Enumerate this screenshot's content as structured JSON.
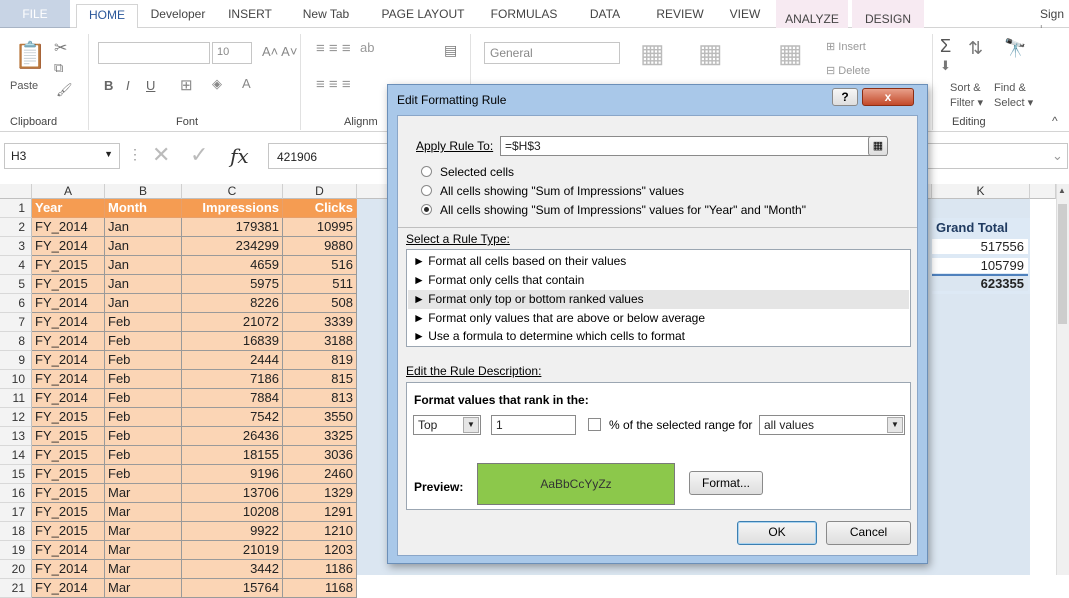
{
  "ribbon_tabs": [
    "FILE",
    "HOME",
    "Developer",
    "INSERT",
    "New Tab",
    "PAGE LAYOUT",
    "FORMULAS",
    "DATA",
    "REVIEW",
    "VIEW",
    "ANALYZE",
    "DESIGN"
  ],
  "sign_in": "Sign i",
  "ribbon": {
    "clipboard": {
      "label": "Clipboard",
      "paste": "Paste"
    },
    "font": {
      "label": "Font",
      "size": "10",
      "bold": "B",
      "italic": "I",
      "underline": "U"
    },
    "alignment": {
      "label": "Alignm"
    },
    "number": {
      "format": "General"
    },
    "cells": {
      "insert": "Insert",
      "delete": "Delete"
    },
    "editing": {
      "label": "Editing",
      "sort": "Sort &",
      "filter": "Filter",
      "find": "Find &",
      "select": "Select"
    }
  },
  "formula_bar": {
    "name_box": "H3",
    "fx": "fx",
    "value": "421906"
  },
  "columns": [
    "A",
    "B",
    "C",
    "D"
  ],
  "col_k": "K",
  "table": {
    "headers": [
      "Year",
      "Month",
      "Impressions",
      "Clicks"
    ],
    "rows": [
      [
        "FY_2014",
        "Jan",
        "179381",
        "10995"
      ],
      [
        "FY_2014",
        "Jan",
        "234299",
        "9880"
      ],
      [
        "FY_2015",
        "Jan",
        "4659",
        "516"
      ],
      [
        "FY_2015",
        "Jan",
        "5975",
        "511"
      ],
      [
        "FY_2014",
        "Jan",
        "8226",
        "508"
      ],
      [
        "FY_2014",
        "Feb",
        "21072",
        "3339"
      ],
      [
        "FY_2014",
        "Feb",
        "16839",
        "3188"
      ],
      [
        "FY_2014",
        "Feb",
        "2444",
        "819"
      ],
      [
        "FY_2014",
        "Feb",
        "7186",
        "815"
      ],
      [
        "FY_2014",
        "Feb",
        "7884",
        "813"
      ],
      [
        "FY_2015",
        "Feb",
        "7542",
        "3550"
      ],
      [
        "FY_2015",
        "Feb",
        "26436",
        "3325"
      ],
      [
        "FY_2015",
        "Feb",
        "18155",
        "3036"
      ],
      [
        "FY_2015",
        "Feb",
        "9196",
        "2460"
      ],
      [
        "FY_2015",
        "Mar",
        "13706",
        "1329"
      ],
      [
        "FY_2015",
        "Mar",
        "10208",
        "1291"
      ],
      [
        "FY_2015",
        "Mar",
        "9922",
        "1210"
      ],
      [
        "FY_2014",
        "Mar",
        "21019",
        "1203"
      ],
      [
        "FY_2014",
        "Mar",
        "3442",
        "1186"
      ],
      [
        "FY_2014",
        "Mar",
        "15764",
        "1168"
      ]
    ]
  },
  "grand_total": {
    "label": "Grand Total",
    "values": [
      "517556",
      "105799",
      "623355"
    ]
  },
  "dialog": {
    "title": "Edit Formatting Rule",
    "apply_label": "Apply Rule To:",
    "apply_value": "=$H$3",
    "scope_options": [
      "Selected cells",
      "All cells showing \"Sum of Impressions\" values",
      "All cells showing \"Sum of Impressions\" values for \"Year\" and \"Month\""
    ],
    "scope_selected": 2,
    "rule_type_label": "Select a Rule Type:",
    "rule_types": [
      "► Format all cells based on their values",
      "► Format only cells that contain",
      "► Format only top or bottom ranked values",
      "► Format only values that are above or below average",
      "► Use a formula to determine which cells to format"
    ],
    "rule_type_selected": 2,
    "desc_label": "Edit the Rule Description:",
    "rank_label": "Format values that rank in the:",
    "top_bottom": "Top",
    "rank_value": "1",
    "percent_label": "% of the selected range for",
    "scope_value": "all values",
    "preview_label": "Preview:",
    "preview_text": "AaBbCcYyZz",
    "preview_color": "#8cc84b",
    "format_button": "Format...",
    "ok": "OK",
    "cancel": "Cancel",
    "help": "?",
    "close": "x"
  }
}
